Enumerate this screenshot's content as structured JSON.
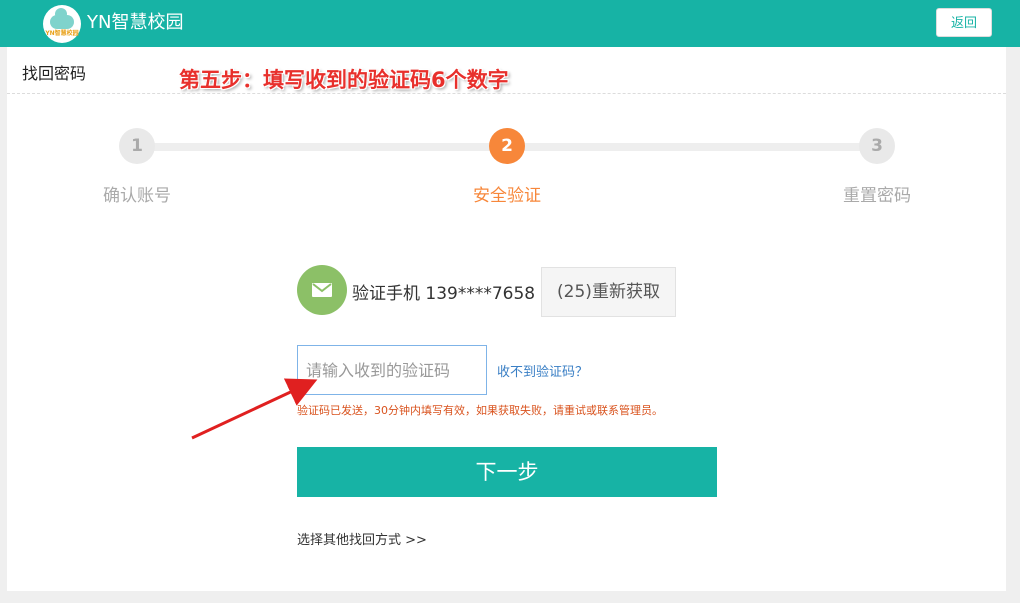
{
  "header": {
    "logo_text": "YN智慧校园",
    "title": "YN智慧校园",
    "back_label": "返回"
  },
  "page": {
    "title": "找回密码",
    "annotation": "第五步：填写收到的验证码6个数字"
  },
  "steps": [
    {
      "number": "1",
      "label": "确认账号",
      "active": false
    },
    {
      "number": "2",
      "label": "安全验证",
      "active": true
    },
    {
      "number": "3",
      "label": "重置密码",
      "active": false
    }
  ],
  "verify": {
    "phone_label": "验证手机 139****7658",
    "resend_label": "(25)重新获取",
    "code_placeholder": "请输入收到的验证码",
    "code_value": "",
    "no_code_link": "收不到验证码？",
    "hint": "验证码已发送，30分钟内填写有效，如果获取失败，请重试或联系管理员。"
  },
  "actions": {
    "next_label": "下一步",
    "other_method": "选择其他找回方式 >>"
  },
  "colors": {
    "brand": "#17b3a5",
    "active_step": "#f7873a",
    "annotation": "#e8302c",
    "phone_icon": "#8cc067",
    "link": "#3a7fc5",
    "hint": "#d9531e"
  },
  "icons": {
    "phone": "envelope-icon",
    "annotation_arrow": "red-arrow-icon"
  }
}
